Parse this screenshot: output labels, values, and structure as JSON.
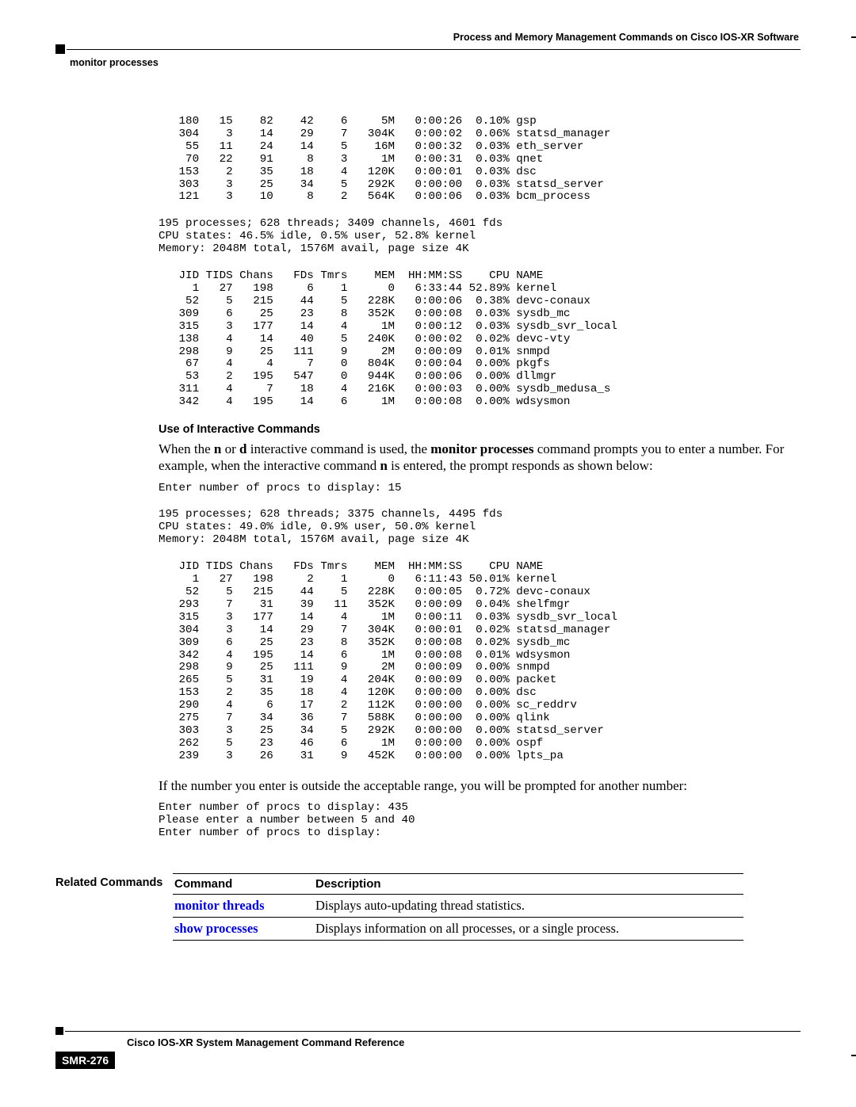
{
  "header": {
    "chapter_title": "Process and Memory Management Commands on Cisco IOS-XR Software",
    "section_label": "monitor processes"
  },
  "block1": {
    "rows": [
      {
        "jid": "180",
        "tids": "15",
        "chans": "82",
        "fds": "42",
        "tmrs": "6",
        "mem": "5M",
        "time": "0:00:26",
        "cpu": "0.10%",
        "name": "gsp"
      },
      {
        "jid": "304",
        "tids": "3",
        "chans": "14",
        "fds": "29",
        "tmrs": "7",
        "mem": "304K",
        "time": "0:00:02",
        "cpu": "0.06%",
        "name": "statsd_manager"
      },
      {
        "jid": "55",
        "tids": "11",
        "chans": "24",
        "fds": "14",
        "tmrs": "5",
        "mem": "16M",
        "time": "0:00:32",
        "cpu": "0.03%",
        "name": "eth_server"
      },
      {
        "jid": "70",
        "tids": "22",
        "chans": "91",
        "fds": "8",
        "tmrs": "3",
        "mem": "1M",
        "time": "0:00:31",
        "cpu": "0.03%",
        "name": "qnet"
      },
      {
        "jid": "153",
        "tids": "2",
        "chans": "35",
        "fds": "18",
        "tmrs": "4",
        "mem": "120K",
        "time": "0:00:01",
        "cpu": "0.03%",
        "name": "dsc"
      },
      {
        "jid": "303",
        "tids": "3",
        "chans": "25",
        "fds": "34",
        "tmrs": "5",
        "mem": "292K",
        "time": "0:00:00",
        "cpu": "0.03%",
        "name": "statsd_server"
      },
      {
        "jid": "121",
        "tids": "3",
        "chans": "10",
        "fds": "8",
        "tmrs": "2",
        "mem": "564K",
        "time": "0:00:06",
        "cpu": "0.03%",
        "name": "bcm_process"
      }
    ]
  },
  "summary1": {
    "line1": "195 processes; 628 threads; 3409 channels, 4601 fds",
    "line2": "CPU states: 46.5% idle, 0.5% user, 52.8% kernel",
    "line3": "Memory: 2048M total, 1576M avail, page size 4K"
  },
  "hdr_cols": {
    "jid": "JID",
    "tids": "TIDS",
    "chans": "Chans",
    "fds": "FDs",
    "tmrs": "Tmrs",
    "mem": "MEM",
    "time": "HH:MM:SS",
    "cpu": "CPU",
    "name": "NAME"
  },
  "block2": {
    "rows": [
      {
        "jid": "1",
        "tids": "27",
        "chans": "198",
        "fds": "6",
        "tmrs": "1",
        "mem": "0",
        "time": "6:33:44",
        "cpu": "52.89%",
        "name": "kernel"
      },
      {
        "jid": "52",
        "tids": "5",
        "chans": "215",
        "fds": "44",
        "tmrs": "5",
        "mem": "228K",
        "time": "0:00:06",
        "cpu": "0.38%",
        "name": "devc-conaux"
      },
      {
        "jid": "309",
        "tids": "6",
        "chans": "25",
        "fds": "23",
        "tmrs": "8",
        "mem": "352K",
        "time": "0:00:08",
        "cpu": "0.03%",
        "name": "sysdb_mc"
      },
      {
        "jid": "315",
        "tids": "3",
        "chans": "177",
        "fds": "14",
        "tmrs": "4",
        "mem": "1M",
        "time": "0:00:12",
        "cpu": "0.03%",
        "name": "sysdb_svr_local"
      },
      {
        "jid": "138",
        "tids": "4",
        "chans": "14",
        "fds": "40",
        "tmrs": "5",
        "mem": "240K",
        "time": "0:00:02",
        "cpu": "0.02%",
        "name": "devc-vty"
      },
      {
        "jid": "298",
        "tids": "9",
        "chans": "25",
        "fds": "111",
        "tmrs": "9",
        "mem": "2M",
        "time": "0:00:09",
        "cpu": "0.01%",
        "name": "snmpd"
      },
      {
        "jid": "67",
        "tids": "4",
        "chans": "4",
        "fds": "7",
        "tmrs": "0",
        "mem": "804K",
        "time": "0:00:04",
        "cpu": "0.00%",
        "name": "pkgfs"
      },
      {
        "jid": "53",
        "tids": "2",
        "chans": "195",
        "fds": "547",
        "tmrs": "0",
        "mem": "944K",
        "time": "0:00:06",
        "cpu": "0.00%",
        "name": "dllmgr"
      },
      {
        "jid": "311",
        "tids": "4",
        "chans": "7",
        "fds": "18",
        "tmrs": "4",
        "mem": "216K",
        "time": "0:00:03",
        "cpu": "0.00%",
        "name": "sysdb_medusa_s"
      },
      {
        "jid": "342",
        "tids": "4",
        "chans": "195",
        "fds": "14",
        "tmrs": "6",
        "mem": "1M",
        "time": "0:00:08",
        "cpu": "0.00%",
        "name": "wdsysmon"
      }
    ]
  },
  "subheading": "Use of Interactive Commands",
  "para1": {
    "pre1": "When the ",
    "b1": "n",
    "mid1": " or ",
    "b2": "d",
    "mid2": " interactive command is used, the ",
    "b3": "monitor processes",
    "mid3": " command prompts you to enter a number. For example, when the interactive command ",
    "b4": "n",
    "post": " is entered, the prompt responds as shown below:"
  },
  "prompt1": "Enter number of procs to display: 15",
  "summary2": {
    "line1": "195 processes; 628 threads; 3375 channels, 4495 fds",
    "line2": "CPU states: 49.0% idle, 0.9% user, 50.0% kernel",
    "line3": "Memory: 2048M total, 1576M avail, page size 4K"
  },
  "block3": {
    "rows": [
      {
        "jid": "1",
        "tids": "27",
        "chans": "198",
        "fds": "2",
        "tmrs": "1",
        "mem": "0",
        "time": "6:11:43",
        "cpu": "50.01%",
        "name": "kernel"
      },
      {
        "jid": "52",
        "tids": "5",
        "chans": "215",
        "fds": "44",
        "tmrs": "5",
        "mem": "228K",
        "time": "0:00:05",
        "cpu": "0.72%",
        "name": "devc-conaux"
      },
      {
        "jid": "293",
        "tids": "7",
        "chans": "31",
        "fds": "39",
        "tmrs": "11",
        "mem": "352K",
        "time": "0:00:09",
        "cpu": "0.04%",
        "name": "shelfmgr"
      },
      {
        "jid": "315",
        "tids": "3",
        "chans": "177",
        "fds": "14",
        "tmrs": "4",
        "mem": "1M",
        "time": "0:00:11",
        "cpu": "0.03%",
        "name": "sysdb_svr_local"
      },
      {
        "jid": "304",
        "tids": "3",
        "chans": "14",
        "fds": "29",
        "tmrs": "7",
        "mem": "304K",
        "time": "0:00:01",
        "cpu": "0.02%",
        "name": "statsd_manager"
      },
      {
        "jid": "309",
        "tids": "6",
        "chans": "25",
        "fds": "23",
        "tmrs": "8",
        "mem": "352K",
        "time": "0:00:08",
        "cpu": "0.02%",
        "name": "sysdb_mc"
      },
      {
        "jid": "342",
        "tids": "4",
        "chans": "195",
        "fds": "14",
        "tmrs": "6",
        "mem": "1M",
        "time": "0:00:08",
        "cpu": "0.01%",
        "name": "wdsysmon"
      },
      {
        "jid": "298",
        "tids": "9",
        "chans": "25",
        "fds": "111",
        "tmrs": "9",
        "mem": "2M",
        "time": "0:00:09",
        "cpu": "0.00%",
        "name": "snmpd"
      },
      {
        "jid": "265",
        "tids": "5",
        "chans": "31",
        "fds": "19",
        "tmrs": "4",
        "mem": "204K",
        "time": "0:00:09",
        "cpu": "0.00%",
        "name": "packet"
      },
      {
        "jid": "153",
        "tids": "2",
        "chans": "35",
        "fds": "18",
        "tmrs": "4",
        "mem": "120K",
        "time": "0:00:00",
        "cpu": "0.00%",
        "name": "dsc"
      },
      {
        "jid": "290",
        "tids": "4",
        "chans": "6",
        "fds": "17",
        "tmrs": "2",
        "mem": "112K",
        "time": "0:00:00",
        "cpu": "0.00%",
        "name": "sc_reddrv"
      },
      {
        "jid": "275",
        "tids": "7",
        "chans": "34",
        "fds": "36",
        "tmrs": "7",
        "mem": "588K",
        "time": "0:00:00",
        "cpu": "0.00%",
        "name": "qlink"
      },
      {
        "jid": "303",
        "tids": "3",
        "chans": "25",
        "fds": "34",
        "tmrs": "5",
        "mem": "292K",
        "time": "0:00:00",
        "cpu": "0.00%",
        "name": "statsd_server"
      },
      {
        "jid": "262",
        "tids": "5",
        "chans": "23",
        "fds": "46",
        "tmrs": "6",
        "mem": "1M",
        "time": "0:00:00",
        "cpu": "0.00%",
        "name": "ospf"
      },
      {
        "jid": "239",
        "tids": "3",
        "chans": "26",
        "fds": "31",
        "tmrs": "9",
        "mem": "452K",
        "time": "0:00:00",
        "cpu": "0.00%",
        "name": "lpts_pa"
      }
    ]
  },
  "para2": "If the number you enter is outside the acceptable range, you will be prompted for another number:",
  "prompt2": {
    "l1": "Enter number of procs to display: 435",
    "l2": "Please enter a number between 5 and 40",
    "l3": "Enter number of procs to display:"
  },
  "related": {
    "side_label": "Related Commands",
    "head_cmd": "Command",
    "head_desc": "Description",
    "rows": [
      {
        "cmd": "monitor threads",
        "desc": "Displays auto-updating thread statistics."
      },
      {
        "cmd": "show processes",
        "desc": "Displays information on all processes, or a single process."
      }
    ]
  },
  "footer": {
    "book_title": "Cisco IOS-XR System Management Command Reference",
    "page_badge": "SMR-276"
  }
}
